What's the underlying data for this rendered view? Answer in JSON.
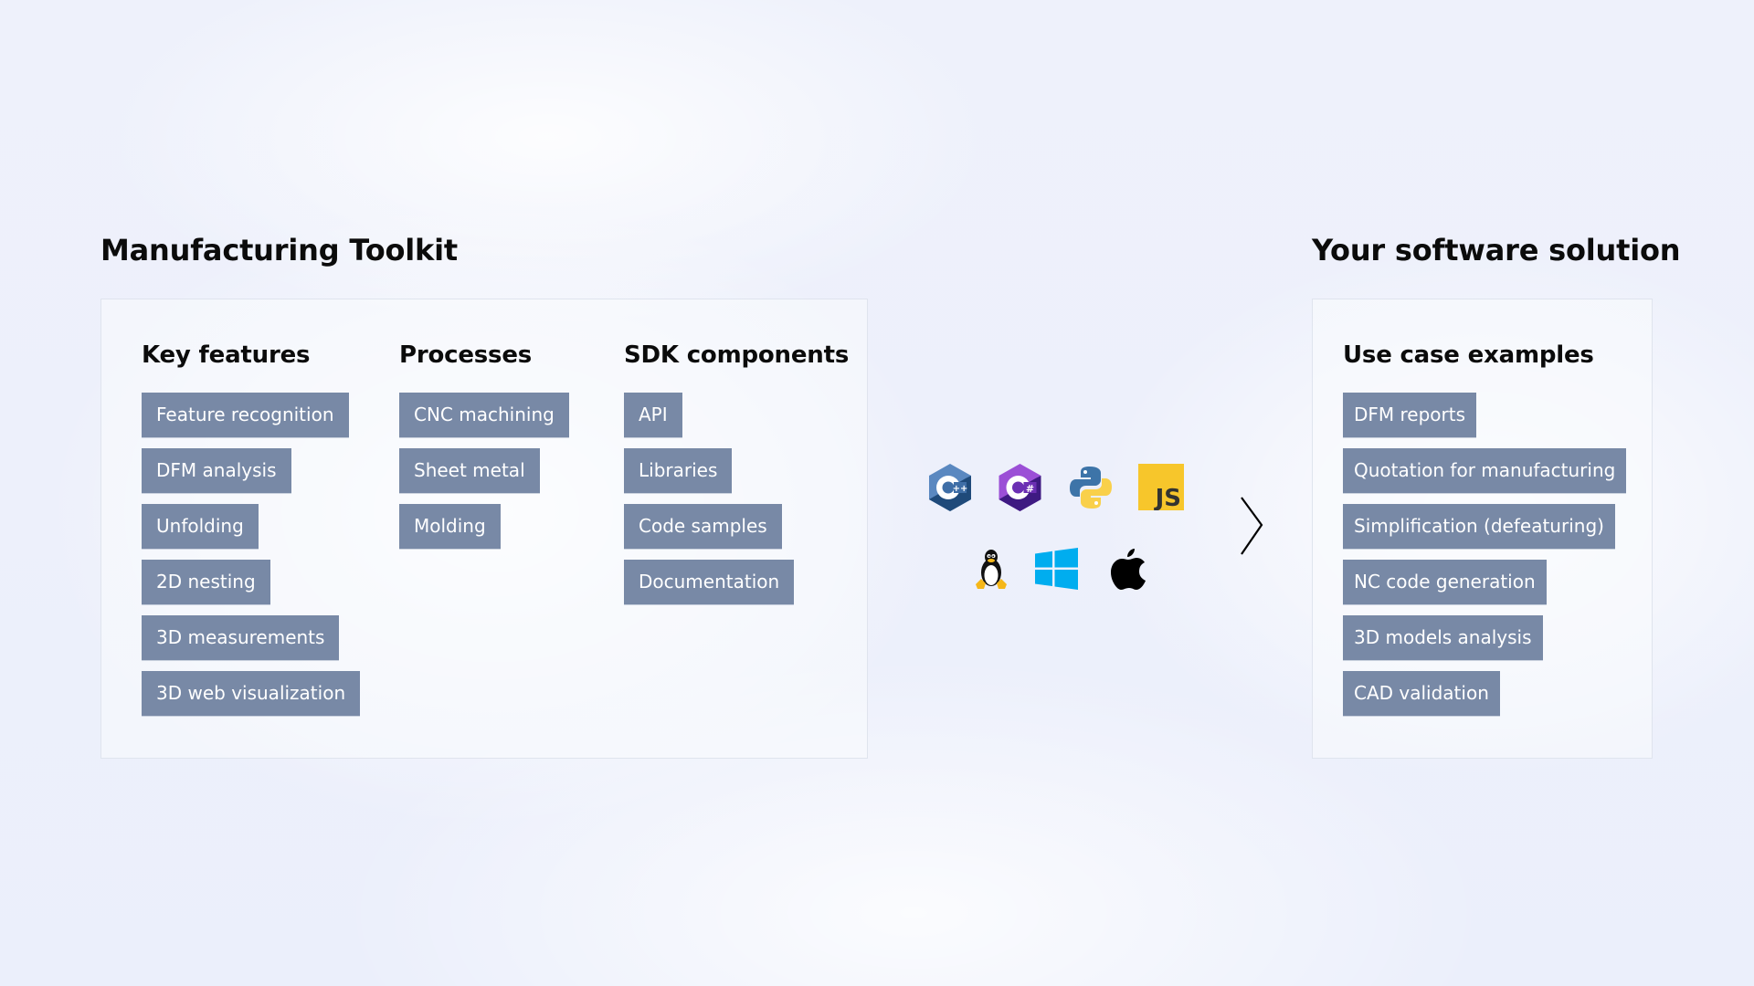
{
  "left_section": {
    "title": "Manufacturing Toolkit",
    "columns": [
      {
        "heading": "Key features",
        "items": [
          "Feature recognition",
          "DFM analysis",
          "Unfolding",
          "2D nesting",
          "3D measurements",
          "3D web visualization"
        ]
      },
      {
        "heading": "Processes",
        "items": [
          "CNC machining",
          "Sheet metal",
          "Molding"
        ]
      },
      {
        "heading": "SDK components",
        "items": [
          "API",
          "Libraries",
          "Code samples",
          "Documentation"
        ]
      }
    ]
  },
  "languages": [
    {
      "name": "C++",
      "icon": "cpp-icon"
    },
    {
      "name": "C#",
      "icon": "csharp-icon"
    },
    {
      "name": "Python",
      "icon": "python-icon"
    },
    {
      "name": "JavaScript",
      "icon": "javascript-icon",
      "label": "JS"
    }
  ],
  "platforms": [
    {
      "name": "Linux",
      "icon": "linux-icon"
    },
    {
      "name": "Windows",
      "icon": "windows-icon"
    },
    {
      "name": "macOS",
      "icon": "apple-icon"
    }
  ],
  "arrow": {
    "icon": "chevron-right-icon"
  },
  "right_section": {
    "title": "Your software solution",
    "column": {
      "heading": "Use case examples",
      "items": [
        "DFM reports",
        "Quotation for manufacturing",
        "Simplification (defeaturing)",
        "NC code generation",
        "3D models analysis",
        "CAD validation"
      ]
    }
  },
  "colors": {
    "tag_background": "#7889a6",
    "tag_text": "#ffffff",
    "heading_text": "#0b0b0b",
    "panel_border": "#dfe4ee",
    "cpp_blue": "#5a88c0",
    "csharp_purple": "#9b4fd6",
    "python_blue": "#3d74a8",
    "python_yellow": "#f9d04a",
    "js_yellow": "#f7c62b",
    "windows_blue": "#00adef"
  }
}
